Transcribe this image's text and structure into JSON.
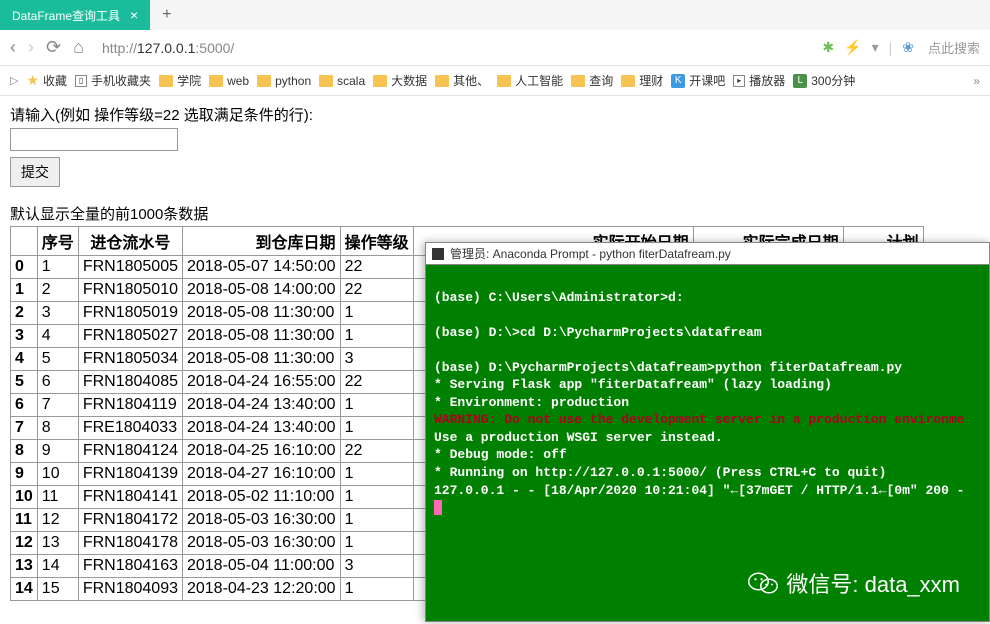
{
  "tab": {
    "title": "DataFrame查询工具"
  },
  "url": {
    "prefix": "http://",
    "host": "127.0.0.1",
    "port": ":5000/"
  },
  "search_placeholder": "点此搜索",
  "bookmarks": {
    "fav": "收藏",
    "mobile": "手机收藏夹",
    "items": [
      "学院",
      "web",
      "python",
      "scala",
      "大数据",
      "其他、",
      "人工智能",
      "查询",
      "理财"
    ],
    "kaikeba": "开课吧",
    "player": "播放器",
    "last": "300分钟"
  },
  "page": {
    "instruction": "请输入(例如 操作等级=22 选取满足条件的行):",
    "submit": "提交",
    "data_label": "默认显示全量的前1000条数据"
  },
  "columns": [
    "",
    "序号",
    "进仓流水号",
    "到仓库日期",
    "操作等级",
    "实际开始日期",
    "实际完成日期",
    "计划"
  ],
  "rows": [
    {
      "idx": "0",
      "seq": "1",
      "no": "FRN1805005",
      "date": "2018-05-07 14:50:00",
      "lvl": "22"
    },
    {
      "idx": "1",
      "seq": "2",
      "no": "FRN1805010",
      "date": "2018-05-08 14:00:00",
      "lvl": "22"
    },
    {
      "idx": "2",
      "seq": "3",
      "no": "FRN1805019",
      "date": "2018-05-08 11:30:00",
      "lvl": "1"
    },
    {
      "idx": "3",
      "seq": "4",
      "no": "FRN1805027",
      "date": "2018-05-08 11:30:00",
      "lvl": "1"
    },
    {
      "idx": "4",
      "seq": "5",
      "no": "FRN1805034",
      "date": "2018-05-08 11:30:00",
      "lvl": "3"
    },
    {
      "idx": "5",
      "seq": "6",
      "no": "FRN1804085",
      "date": "2018-04-24 16:55:00",
      "lvl": "22"
    },
    {
      "idx": "6",
      "seq": "7",
      "no": "FRN1804119",
      "date": "2018-04-24 13:40:00",
      "lvl": "1"
    },
    {
      "idx": "7",
      "seq": "8",
      "no": "FRE1804033",
      "date": "2018-04-24 13:40:00",
      "lvl": "1"
    },
    {
      "idx": "8",
      "seq": "9",
      "no": "FRN1804124",
      "date": "2018-04-25 16:10:00",
      "lvl": "22"
    },
    {
      "idx": "9",
      "seq": "10",
      "no": "FRN1804139",
      "date": "2018-04-27 16:10:00",
      "lvl": "1"
    },
    {
      "idx": "10",
      "seq": "11",
      "no": "FRN1804141",
      "date": "2018-05-02 11:10:00",
      "lvl": "1"
    },
    {
      "idx": "11",
      "seq": "12",
      "no": "FRN1804172",
      "date": "2018-05-03 16:30:00",
      "lvl": "1"
    },
    {
      "idx": "12",
      "seq": "13",
      "no": "FRN1804178",
      "date": "2018-05-03 16:30:00",
      "lvl": "1"
    },
    {
      "idx": "13",
      "seq": "14",
      "no": "FRN1804163",
      "date": "2018-05-04 11:00:00",
      "lvl": "3"
    },
    {
      "idx": "14",
      "seq": "15",
      "no": "FRN1804093",
      "date": "2018-04-23 12:20:00",
      "lvl": "1"
    }
  ],
  "terminal": {
    "title": "管理员: Anaconda Prompt - python  fiterDatafream.py",
    "lines": [
      {
        "t": "",
        "c": "y"
      },
      {
        "t": "(base) C:\\Users\\Administrator>d:",
        "c": "y"
      },
      {
        "t": "",
        "c": "y"
      },
      {
        "t": "(base) D:\\>cd D:\\PycharmProjects\\datafream",
        "c": "y"
      },
      {
        "t": "",
        "c": "y"
      },
      {
        "t": "(base) D:\\PycharmProjects\\datafream>python fiterDatafream.py",
        "c": "y"
      },
      {
        "t": " * Serving Flask app \"fiterDatafream\" (lazy loading)",
        "c": "y"
      },
      {
        "t": " * Environment: production",
        "c": "y"
      },
      {
        "t": "   WARNING: Do not use the development server in a production environme",
        "c": "warn"
      },
      {
        "t": "   Use a production WSGI server instead.",
        "c": "y"
      },
      {
        "t": " * Debug mode: off",
        "c": "y"
      },
      {
        "t": " * Running on http://127.0.0.1:5000/ (Press CTRL+C to quit)",
        "c": "y"
      },
      {
        "t": "127.0.0.1 - - [18/Apr/2020 10:21:04] \"←[37mGET / HTTP/1.1←[0m\" 200 -",
        "c": "y"
      }
    ]
  },
  "watermark": "微信号: data_xxm"
}
